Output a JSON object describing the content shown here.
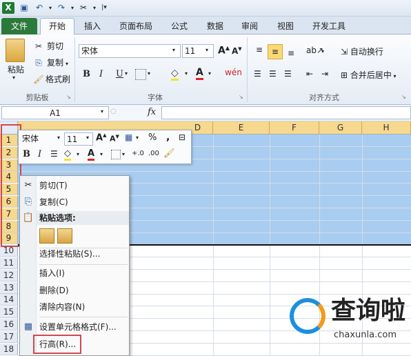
{
  "tabs": [
    "文件",
    "开始",
    "插入",
    "页面布局",
    "公式",
    "数据",
    "审阅",
    "视图",
    "开发工具"
  ],
  "clipboard": {
    "paste": "粘贴",
    "cut": "剪切",
    "copy": "复制",
    "painter": "格式刷",
    "label": "剪贴板"
  },
  "font": {
    "name": "宋体",
    "size": "11",
    "label": "字体",
    "bold": "B",
    "italic": "I",
    "underline": "U"
  },
  "align": {
    "wrap": "自动换行",
    "merge": "合并后居中",
    "label": "对齐方式"
  },
  "formula": {
    "namebox": "A1",
    "fx": "fx"
  },
  "columns": [
    "D",
    "E",
    "F",
    "G",
    "H"
  ],
  "rows": [
    "1",
    "2",
    "3",
    "4",
    "5",
    "6",
    "7",
    "8",
    "9",
    "10",
    "11",
    "12",
    "13",
    "14",
    "15",
    "16",
    "17",
    "18"
  ],
  "minitb": {
    "font": "宋体",
    "size": "11",
    "percent": "%",
    "comma": ","
  },
  "menu": {
    "cut": "剪切(T)",
    "copy": "复制(C)",
    "paste_options": "粘贴选项:",
    "paste_special": "选择性粘贴(S)...",
    "insert": "插入(I)",
    "delete": "删除(D)",
    "clear": "清除内容(N)",
    "format": "设置单元格格式(F)...",
    "row_height": "行高(R)..."
  },
  "watermark": {
    "name": "查询啦",
    "url": "chaxunla.com"
  },
  "colors": {
    "file_tab": "#2c7a3b",
    "selection": "#a9cdf0",
    "header_sel": "#f6d88e",
    "highlight": "#d04850"
  }
}
